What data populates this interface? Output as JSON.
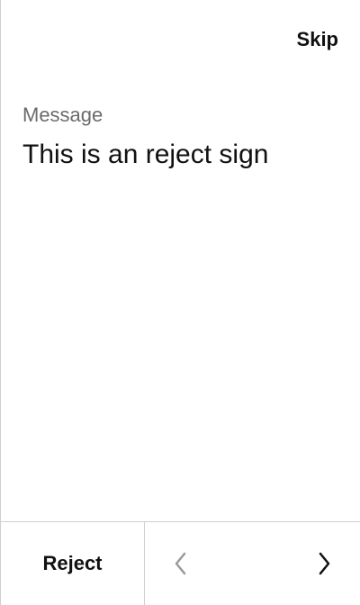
{
  "header": {
    "skip_label": "Skip"
  },
  "content": {
    "label": "Message",
    "message": "This is an reject sign"
  },
  "footer": {
    "reject_label": "Reject",
    "icons": {
      "previous": "chevron-left-icon",
      "next": "chevron-right-icon"
    }
  },
  "colors": {
    "background": "#ffffff",
    "primary_text": "#111111",
    "secondary_text": "#6b6b6b",
    "border": "#cfcfcf",
    "disabled_icon": "#9a9a9a"
  }
}
